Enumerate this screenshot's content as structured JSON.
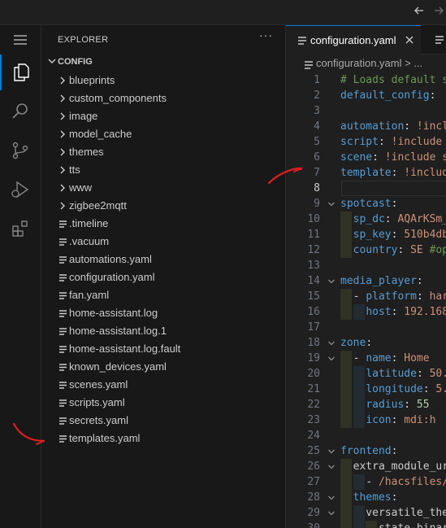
{
  "explorer": {
    "title": "EXPLORER",
    "more_label": "···",
    "root": "CONFIG",
    "items": [
      {
        "label": "blueprints",
        "kind": "folder"
      },
      {
        "label": "custom_components",
        "kind": "folder"
      },
      {
        "label": "image",
        "kind": "folder"
      },
      {
        "label": "model_cache",
        "kind": "folder"
      },
      {
        "label": "themes",
        "kind": "folder"
      },
      {
        "label": "tts",
        "kind": "folder"
      },
      {
        "label": "www",
        "kind": "folder"
      },
      {
        "label": "zigbee2mqtt",
        "kind": "folder"
      },
      {
        "label": ".timeline",
        "kind": "file"
      },
      {
        "label": ".vacuum",
        "kind": "file"
      },
      {
        "label": "automations.yaml",
        "kind": "file"
      },
      {
        "label": "configuration.yaml",
        "kind": "file"
      },
      {
        "label": "fan.yaml",
        "kind": "file"
      },
      {
        "label": "home-assistant.log",
        "kind": "file"
      },
      {
        "label": "home-assistant.log.1",
        "kind": "file"
      },
      {
        "label": "home-assistant.log.fault",
        "kind": "file"
      },
      {
        "label": "known_devices.yaml",
        "kind": "file"
      },
      {
        "label": "scenes.yaml",
        "kind": "file"
      },
      {
        "label": "scripts.yaml",
        "kind": "file"
      },
      {
        "label": "secrets.yaml",
        "kind": "file"
      },
      {
        "label": "templates.yaml",
        "kind": "file"
      }
    ]
  },
  "editor": {
    "tab_label": "configuration.yaml",
    "breadcrumb": "configuration.yaml > ...",
    "current_line": 8,
    "lines": [
      {
        "n": "1",
        "text": "# Loads default s"
      },
      {
        "n": "2",
        "text": "default_config:"
      },
      {
        "n": "3",
        "text": ""
      },
      {
        "n": "4",
        "text": "automation: !incl"
      },
      {
        "n": "5",
        "text": "script: !include "
      },
      {
        "n": "6",
        "text": "scene: !include s"
      },
      {
        "n": "7",
        "text": "template: !includ"
      },
      {
        "n": "8",
        "text": ""
      },
      {
        "n": "9",
        "text": "spotcast:"
      },
      {
        "n": "10",
        "text": "  sp_dc: AQArKSm_"
      },
      {
        "n": "11",
        "text": "  sp_key: 510b4db"
      },
      {
        "n": "12",
        "text": "  country: SE #op"
      },
      {
        "n": "13",
        "text": ""
      },
      {
        "n": "14",
        "text": "media_player:"
      },
      {
        "n": "15",
        "text": "  - platform: har"
      },
      {
        "n": "16",
        "text": "    host: 192.168"
      },
      {
        "n": "17",
        "text": ""
      },
      {
        "n": "18",
        "text": "zone:"
      },
      {
        "n": "19",
        "text": "  - name: Home"
      },
      {
        "n": "20",
        "text": "    latitude: 50."
      },
      {
        "n": "21",
        "text": "    longitude: 5."
      },
      {
        "n": "22",
        "text": "    radius: 55"
      },
      {
        "n": "23",
        "text": "    icon: mdi:h"
      },
      {
        "n": "24",
        "text": ""
      },
      {
        "n": "25",
        "text": "frontend:"
      },
      {
        "n": "26",
        "text": "  extra_module_ur"
      },
      {
        "n": "27",
        "text": "    - /hacsfiles/"
      },
      {
        "n": "28",
        "text": "  themes:"
      },
      {
        "n": "29",
        "text": "    versatile_the"
      },
      {
        "n": "30",
        "text": "      state-binar"
      }
    ]
  },
  "colors": {
    "accent": "#0078d4",
    "annotation": "#e01e1e"
  }
}
